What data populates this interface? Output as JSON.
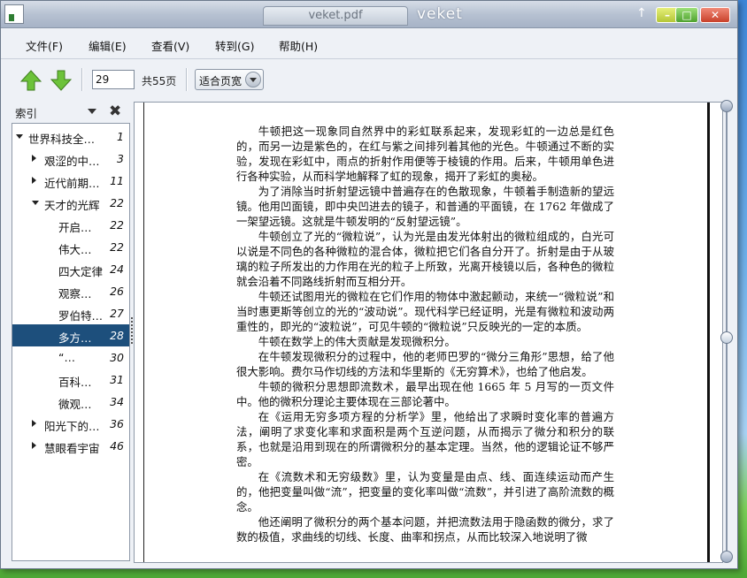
{
  "window": {
    "tab_title": "veket.pdf",
    "app_name": "veket"
  },
  "menu": [
    "文件(F)",
    "编辑(E)",
    "查看(V)",
    "转到(G)",
    "帮助(H)"
  ],
  "toolbar": {
    "page_value": "29",
    "page_total": "共55页",
    "zoom": "适合页宽"
  },
  "sidebar": {
    "label": "索引",
    "items": [
      {
        "label": "世界科技全…",
        "page": "1",
        "level": 0,
        "state": "expanded",
        "selected": false
      },
      {
        "label": "艰涩的中…",
        "page": "3",
        "level": 1,
        "state": "collapsed",
        "selected": false
      },
      {
        "label": "近代前期…",
        "page": "11",
        "level": 1,
        "state": "collapsed",
        "selected": false
      },
      {
        "label": "天才的光辉",
        "page": "22",
        "level": 1,
        "state": "expanded",
        "selected": false
      },
      {
        "label": "开启…",
        "page": "22",
        "level": 2,
        "state": "leaf",
        "selected": false
      },
      {
        "label": "伟大…",
        "page": "22",
        "level": 2,
        "state": "leaf",
        "selected": false
      },
      {
        "label": "四大定律",
        "page": "24",
        "level": 2,
        "state": "leaf",
        "selected": false
      },
      {
        "label": "观察…",
        "page": "26",
        "level": 2,
        "state": "leaf",
        "selected": false
      },
      {
        "label": "罗伯特…",
        "page": "27",
        "level": 2,
        "state": "leaf",
        "selected": false
      },
      {
        "label": "多方…",
        "page": "28",
        "level": 2,
        "state": "leaf",
        "selected": true
      },
      {
        "label": "“…",
        "page": "30",
        "level": 2,
        "state": "leaf",
        "selected": false
      },
      {
        "label": "百科…",
        "page": "31",
        "level": 2,
        "state": "leaf",
        "selected": false
      },
      {
        "label": "微观…",
        "page": "34",
        "level": 2,
        "state": "leaf",
        "selected": false
      },
      {
        "label": "阳光下的…",
        "page": "36",
        "level": 1,
        "state": "collapsed",
        "selected": false
      },
      {
        "label": "慧眼看宇宙",
        "page": "46",
        "level": 1,
        "state": "collapsed",
        "selected": false
      }
    ]
  },
  "document": {
    "paragraphs": [
      "牛顿把这一现象同自然界中的彩虹联系起来，发现彩虹的一边总是红色的，而另一边是紫色的，在红与紫之间排列着其他的光色。牛顿通过不断的实验，发现在彩虹中，雨点的折射作用便等于棱镜的作用。后来，牛顿用单色进行各种实验，从而科学地解释了虹的现象，揭开了彩虹的奥秘。",
      "为了消除当时折射望远镜中普遍存在的色散现象，牛顿着手制造新的望远镜。他用凹面镜，即中央凹进去的镜子，和普通的平面镜，在 1762 年做成了一架望远镜。这就是牛顿发明的“反射望远镜”。",
      "牛顿创立了光的“微粒说”，认为光是由发光体射出的微粒组成的，白光可以说是不同色的各种微粒的混合体，微粒把它们各自分开了。折射是由于从玻璃的粒子所发出的力作用在光的粒子上所致，光离开棱镜以后，各种色的微粒就会沿着不同路线折射而互相分开。",
      "牛顿还试图用光的微粒在它们作用的物体中激起颤动，来统一“微粒说”和当时惠更斯等创立的光的“波动说”。现代科学已经证明，光是有微粒和波动两重性的，即光的“波粒说”，可见牛顿的“微粒说”只反映光的一定的本质。",
      "牛顿在数学上的伟大贡献是发现微积分。",
      "在牛顿发现微积分的过程中，他的老师巴罗的“微分三角形”思想，给了他很大影响。费尔马作切线的方法和华里斯的《无穷算术》，也给了他启发。",
      "牛顿的微积分思想即流数术，最早出现在他 1665 年 5 月写的一页文件中。他的微积分理论主要体现在三部论著中。",
      "在《运用无穷多项方程的分析学》里，他给出了求瞬时变化率的普遍方法，阐明了求变化率和求面积是两个互逆问题，从而揭示了微分和积分的联系，也就是沿用到现在的所谓微积分的基本定理。当然，他的逻辑论证不够严密。",
      "在《流数术和无穷级数》里，认为变量是由点、线、面连续运动而产生的，他把变量叫做“流”，把变量的变化率叫做“流数”，并引进了高阶流数的概念。",
      "他还阐明了微积分的两个基本问题，并把流数法用于隐函数的微分，求了数的极值，求曲线的切线、长度、曲率和拐点，从而比较深入地说明了微"
    ]
  }
}
